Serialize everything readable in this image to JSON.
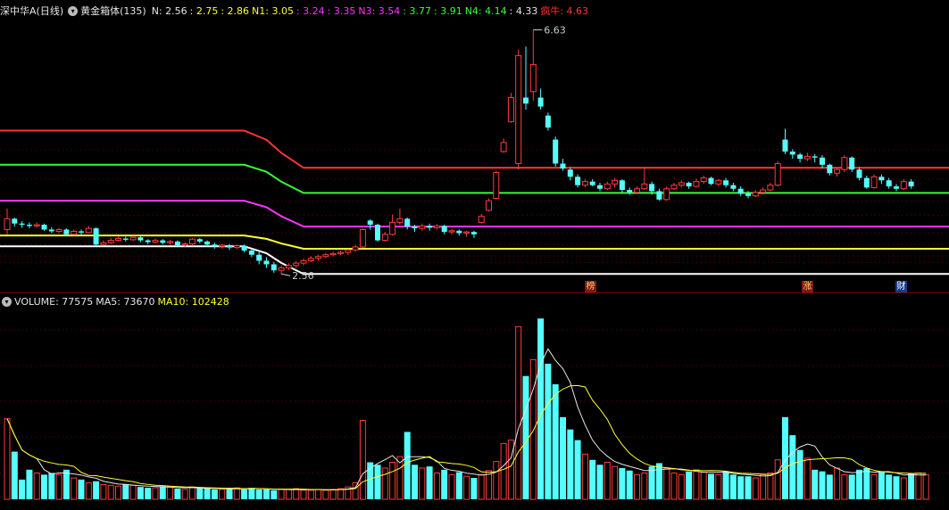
{
  "price_header": {
    "title": "深中华A(日线)",
    "indicator": "黄金箱体(135)",
    "items": [
      {
        "label": "N: 2.56",
        "color": "#e6e6e6"
      },
      {
        "label": ": 2.75",
        "color": "#ffff33"
      },
      {
        "label": ": 2.86",
        "color": "#ffff33"
      },
      {
        "label": "N1: 3.05",
        "color": "#ffff33"
      },
      {
        "label": ": 3.24",
        "color": "#ff33ff"
      },
      {
        "label": ": 3.35",
        "color": "#ff33ff"
      },
      {
        "label": "N3: 3.54",
        "color": "#ff33ff"
      },
      {
        "label": ": 3.77",
        "color": "#33ff33"
      },
      {
        "label": ": 3.91",
        "color": "#33ff33"
      },
      {
        "label": "N4: 4.14",
        "color": "#33ff33"
      },
      {
        "label": ": 4.33",
        "color": "#e6e6e6"
      },
      {
        "label": "疯牛: 4.63",
        "color": "#ff3333"
      }
    ]
  },
  "volume_header": {
    "items": [
      {
        "label": "VOLUME: 77575",
        "color": "#e6e6e6"
      },
      {
        "label": "MA5: 73670",
        "color": "#e6e6e6"
      },
      {
        "label": "MA10: 102428",
        "color": "#ffff33"
      }
    ]
  },
  "annotations": {
    "high_label": "6.63",
    "low_label": "2.56"
  },
  "tags": [
    {
      "label": "榜",
      "bg": "#7a1a1a",
      "fg": "#ffcc66"
    },
    {
      "label": "涨",
      "bg": "#7a1a1a",
      "fg": "#ffcc66"
    },
    {
      "label": "财",
      "bg": "#1a3a8a",
      "fg": "#ffffff"
    }
  ],
  "colors": {
    "up": "#ff3b3b",
    "down": "#54ffff",
    "grid": "#7a0000",
    "ma5": "#e6e6e6",
    "ma10": "#ffff33"
  },
  "chart_data": [
    {
      "type": "candlestick",
      "title": "深中华A(日线)",
      "ylim": [
        2.4,
        6.8
      ],
      "levels": {
        "N": 2.56,
        "N1": 3.05,
        "N3": 3.54,
        "N4": 4.14,
        "疯牛": 4.63
      },
      "box_lines": [
        {
          "name": "white",
          "color": "#ffffff",
          "values": [
            {
              "from": 0,
              "to": 32,
              "v": 3.02
            },
            {
              "from": 40,
              "to": 120,
              "v": 2.56
            }
          ]
        },
        {
          "name": "yellow",
          "color": "#ffff33",
          "values": [
            {
              "from": 0,
              "to": 32,
              "v": 3.2
            },
            {
              "from": 40,
              "to": 120,
              "v": 2.98
            }
          ]
        },
        {
          "name": "magenta",
          "color": "#ff33ff",
          "values": [
            {
              "from": 0,
              "to": 32,
              "v": 3.78
            },
            {
              "from": 40,
              "to": 120,
              "v": 3.35
            }
          ]
        },
        {
          "name": "green",
          "color": "#33ff33",
          "values": [
            {
              "from": 0,
              "to": 32,
              "v": 4.38
            },
            {
              "from": 40,
              "to": 120,
              "v": 3.91
            }
          ]
        },
        {
          "name": "red",
          "color": "#ff3333",
          "values": [
            {
              "from": 0,
              "to": 32,
              "v": 4.95
            },
            {
              "from": 40,
              "to": 120,
              "v": 4.33
            }
          ]
        }
      ],
      "dotted_levels": [
        2.75,
        2.86,
        3.05,
        3.24,
        3.54,
        3.77,
        4.14,
        4.63
      ],
      "candles": [
        [
          3.3,
          3.48,
          3.65,
          3.22
        ],
        [
          3.48,
          3.4,
          3.5,
          3.35
        ],
        [
          3.4,
          3.38,
          3.44,
          3.33
        ],
        [
          3.38,
          3.36,
          3.42,
          3.32
        ],
        [
          3.36,
          3.38,
          3.42,
          3.33
        ],
        [
          3.38,
          3.3,
          3.4,
          3.28
        ],
        [
          3.3,
          3.27,
          3.34,
          3.24
        ],
        [
          3.27,
          3.3,
          3.33,
          3.24
        ],
        [
          3.3,
          3.22,
          3.32,
          3.2
        ],
        [
          3.22,
          3.27,
          3.3,
          3.21
        ],
        [
          3.27,
          3.25,
          3.3,
          3.22
        ],
        [
          3.25,
          3.32,
          3.36,
          3.24
        ],
        [
          3.32,
          3.05,
          3.34,
          3.03
        ],
        [
          3.05,
          3.08,
          3.12,
          3.03
        ],
        [
          3.08,
          3.12,
          3.16,
          3.06
        ],
        [
          3.12,
          3.15,
          3.18,
          3.1
        ],
        [
          3.15,
          3.13,
          3.18,
          3.1
        ],
        [
          3.13,
          3.17,
          3.2,
          3.11
        ],
        [
          3.17,
          3.12,
          3.19,
          3.09
        ],
        [
          3.12,
          3.09,
          3.14,
          3.06
        ],
        [
          3.09,
          3.12,
          3.15,
          3.07
        ],
        [
          3.12,
          3.08,
          3.14,
          3.05
        ],
        [
          3.08,
          3.1,
          3.13,
          3.05
        ],
        [
          3.1,
          3.04,
          3.12,
          3.02
        ],
        [
          3.04,
          3.06,
          3.09,
          3.0
        ],
        [
          3.06,
          3.14,
          3.16,
          3.03
        ],
        [
          3.14,
          3.1,
          3.16,
          3.07
        ],
        [
          3.1,
          3.05,
          3.12,
          3.01
        ],
        [
          3.05,
          3.02,
          3.08,
          2.98
        ],
        [
          3.02,
          3.04,
          3.06,
          2.98
        ],
        [
          3.04,
          3.0,
          3.06,
          2.96
        ],
        [
          3.0,
          3.03,
          3.05,
          2.97
        ],
        [
          3.03,
          2.95,
          3.05,
          2.92
        ],
        [
          2.95,
          2.88,
          2.98,
          2.84
        ],
        [
          2.88,
          2.78,
          2.92,
          2.72
        ],
        [
          2.78,
          2.72,
          2.84,
          2.66
        ],
        [
          2.72,
          2.62,
          2.76,
          2.58
        ],
        [
          2.62,
          2.66,
          2.7,
          2.56
        ],
        [
          2.66,
          2.7,
          2.74,
          2.62
        ],
        [
          2.7,
          2.74,
          2.78,
          2.66
        ],
        [
          2.74,
          2.78,
          2.82,
          2.7
        ],
        [
          2.78,
          2.82,
          2.86,
          2.76
        ],
        [
          2.82,
          2.85,
          2.88,
          2.78
        ],
        [
          2.85,
          2.88,
          2.91,
          2.82
        ],
        [
          2.88,
          2.9,
          2.93,
          2.85
        ],
        [
          2.9,
          2.92,
          2.95,
          2.87
        ],
        [
          2.92,
          2.96,
          2.98,
          2.88
        ],
        [
          2.96,
          3.01,
          3.05,
          2.93
        ],
        [
          3.01,
          3.3,
          3.32,
          2.99
        ],
        [
          3.45,
          3.38,
          3.47,
          3.3
        ],
        [
          3.38,
          3.12,
          3.4,
          3.1
        ],
        [
          3.12,
          3.22,
          3.26,
          3.1
        ],
        [
          3.22,
          3.42,
          3.55,
          3.2
        ],
        [
          3.42,
          3.48,
          3.65,
          3.38
        ],
        [
          3.48,
          3.35,
          3.5,
          3.3
        ],
        [
          3.35,
          3.32,
          3.38,
          3.26
        ],
        [
          3.32,
          3.36,
          3.4,
          3.28
        ],
        [
          3.36,
          3.33,
          3.4,
          3.28
        ],
        [
          3.33,
          3.36,
          3.39,
          3.3
        ],
        [
          3.36,
          3.26,
          3.38,
          3.22
        ],
        [
          3.26,
          3.28,
          3.31,
          3.22
        ],
        [
          3.28,
          3.24,
          3.3,
          3.2
        ],
        [
          3.24,
          3.26,
          3.28,
          3.18
        ],
        [
          3.26,
          3.22,
          3.28,
          3.16
        ],
        [
          3.42,
          3.52,
          3.56,
          3.4
        ],
        [
          3.62,
          3.78,
          3.82,
          3.6
        ],
        [
          3.82,
          4.25,
          4.28,
          3.8
        ],
        [
          4.6,
          4.75,
          4.82,
          4.58
        ],
        [
          5.1,
          5.5,
          5.58,
          5.08
        ],
        [
          4.4,
          6.2,
          6.3,
          4.3
        ],
        [
          5.5,
          5.4,
          6.35,
          5.3
        ],
        [
          5.6,
          6.05,
          6.63,
          5.45
        ],
        [
          5.5,
          5.35,
          5.65,
          5.3
        ],
        [
          5.2,
          5.0,
          5.25,
          4.95
        ],
        [
          4.8,
          4.4,
          4.85,
          4.35
        ],
        [
          4.4,
          4.32,
          4.48,
          4.28
        ],
        [
          4.3,
          4.18,
          4.34,
          4.12
        ],
        [
          4.18,
          4.04,
          4.22,
          4.0
        ],
        [
          4.04,
          4.1,
          4.14,
          4.0
        ],
        [
          4.1,
          4.04,
          4.14,
          4.02
        ],
        [
          4.04,
          3.98,
          4.08,
          3.94
        ],
        [
          3.98,
          4.06,
          4.1,
          3.96
        ],
        [
          4.06,
          4.12,
          4.16,
          4.0
        ],
        [
          4.12,
          3.96,
          4.14,
          3.92
        ],
        [
          3.96,
          3.92,
          4.0,
          3.88
        ],
        [
          3.92,
          3.98,
          4.02,
          3.9
        ],
        [
          3.98,
          4.06,
          4.34,
          3.96
        ],
        [
          4.06,
          3.94,
          4.1,
          3.88
        ],
        [
          3.94,
          3.8,
          3.98,
          3.78
        ],
        [
          3.8,
          3.98,
          4.02,
          3.78
        ],
        [
          3.98,
          4.04,
          4.08,
          3.96
        ],
        [
          4.04,
          4.08,
          4.12,
          4.0
        ],
        [
          4.08,
          4.02,
          4.1,
          3.98
        ],
        [
          4.02,
          4.1,
          4.15,
          4.0
        ],
        [
          4.1,
          4.16,
          4.2,
          4.06
        ],
        [
          4.16,
          4.06,
          4.18,
          4.04
        ],
        [
          4.06,
          4.12,
          4.14,
          4.02
        ],
        [
          4.12,
          4.04,
          4.16,
          4.0
        ],
        [
          4.04,
          3.98,
          4.08,
          3.94
        ],
        [
          3.98,
          3.9,
          4.02,
          3.86
        ],
        [
          3.9,
          3.86,
          3.94,
          3.82
        ],
        [
          3.86,
          3.92,
          3.96,
          3.84
        ],
        [
          3.92,
          3.96,
          4.0,
          3.88
        ],
        [
          3.96,
          4.04,
          4.08,
          3.94
        ],
        [
          4.04,
          4.4,
          4.44,
          4.02
        ],
        [
          4.8,
          4.6,
          4.98,
          4.56
        ],
        [
          4.6,
          4.55,
          4.64,
          4.48
        ],
        [
          4.55,
          4.48,
          4.58,
          4.42
        ],
        [
          4.48,
          4.52,
          4.58,
          4.44
        ],
        [
          4.52,
          4.5,
          4.56,
          4.42
        ],
        [
          4.5,
          4.38,
          4.54,
          4.32
        ],
        [
          4.38,
          4.24,
          4.4,
          4.2
        ],
        [
          4.24,
          4.3,
          4.34,
          4.18
        ],
        [
          4.3,
          4.5,
          4.54,
          4.26
        ],
        [
          4.5,
          4.3,
          4.52,
          4.26
        ],
        [
          4.3,
          4.16,
          4.34,
          4.12
        ],
        [
          4.16,
          4.0,
          4.2,
          3.98
        ],
        [
          4.0,
          4.18,
          4.22,
          3.98
        ],
        [
          4.18,
          4.12,
          4.22,
          4.06
        ],
        [
          4.12,
          4.02,
          4.16,
          3.98
        ],
        [
          4.02,
          3.98,
          4.06,
          3.94
        ],
        [
          3.98,
          4.1,
          4.14,
          3.96
        ],
        [
          4.1,
          4.02,
          4.14,
          3.98
        ]
      ]
    },
    {
      "type": "bar",
      "title": "VOLUME",
      "ylim": [
        0,
        230000
      ],
      "volumes": [
        98000,
        58000,
        24000,
        36000,
        32000,
        30000,
        32000,
        30000,
        36000,
        26000,
        24000,
        20000,
        22000,
        18000,
        17000,
        16000,
        18000,
        17000,
        15000,
        14000,
        14000,
        16000,
        15000,
        13000,
        12000,
        15000,
        14000,
        13000,
        12000,
        12000,
        13000,
        14000,
        12000,
        14000,
        12000,
        12000,
        11000,
        12000,
        12000,
        13000,
        11000,
        11000,
        12000,
        11000,
        12000,
        13000,
        15000,
        20000,
        96000,
        45000,
        42000,
        38000,
        45000,
        52000,
        82000,
        42000,
        38000,
        40000,
        32000,
        36000,
        30000,
        33000,
        28000,
        26000,
        30000,
        35000,
        46000,
        68000,
        72000,
        210000,
        150000,
        170000,
        220000,
        165000,
        140000,
        100000,
        85000,
        72000,
        55000,
        48000,
        42000,
        45000,
        40000,
        38000,
        35000,
        30000,
        32000,
        40000,
        44000,
        38000,
        32000,
        30000,
        34000,
        36000,
        33000,
        31000,
        30000,
        34000,
        30000,
        28000,
        28000,
        26000,
        30000,
        32000,
        48000,
        100000,
        78000,
        60000,
        50000,
        36000,
        34000,
        30000,
        38000,
        30000,
        30000,
        36000,
        38000,
        30000,
        34000,
        30000,
        28000,
        26000,
        32000,
        32000,
        30000
      ]
    }
  ]
}
